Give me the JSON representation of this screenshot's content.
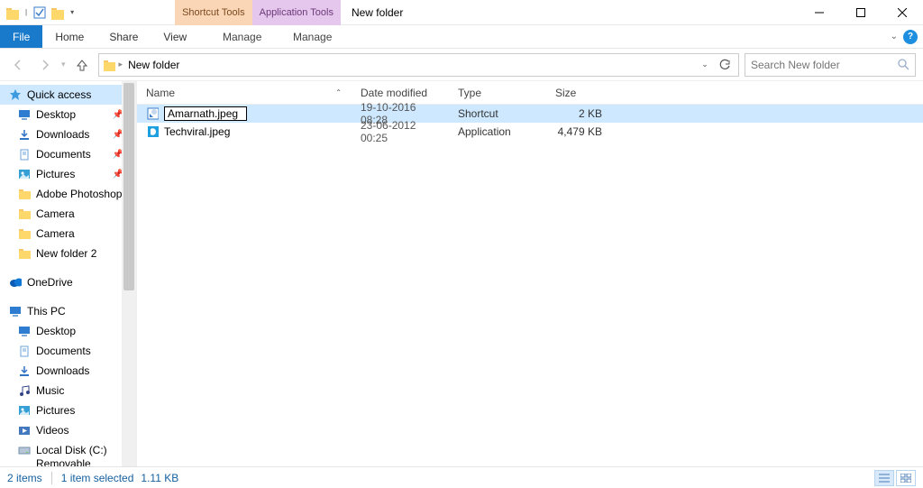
{
  "window": {
    "title": "New folder",
    "context_tabs": {
      "shortcut": "Shortcut Tools",
      "application": "Application Tools"
    },
    "context_sub": {
      "shortcut": "Manage",
      "application": "Manage"
    }
  },
  "ribbon": {
    "file": "File",
    "home": "Home",
    "share": "Share",
    "view": "View"
  },
  "address": {
    "crumb0": "New folder",
    "search_placeholder": "Search New folder"
  },
  "sidebar": {
    "quick_access": "Quick access",
    "items_qa": [
      {
        "label": "Desktop",
        "pin": true
      },
      {
        "label": "Downloads",
        "pin": true
      },
      {
        "label": "Documents",
        "pin": true
      },
      {
        "label": "Pictures",
        "pin": true
      },
      {
        "label": "Adobe Photoshop…",
        "pin": false
      },
      {
        "label": "Camera",
        "pin": false
      },
      {
        "label": "Camera",
        "pin": false
      },
      {
        "label": "New folder 2",
        "pin": false
      }
    ],
    "onedrive": "OneDrive",
    "thispc": "This PC",
    "items_pc": [
      {
        "label": "Desktop"
      },
      {
        "label": "Documents"
      },
      {
        "label": "Downloads"
      },
      {
        "label": "Music"
      },
      {
        "label": "Pictures"
      },
      {
        "label": "Videos"
      },
      {
        "label": "Local Disk (C:)"
      },
      {
        "label": "Removable Disk"
      }
    ]
  },
  "columns": {
    "name": "Name",
    "date": "Date modified",
    "type": "Type",
    "size": "Size"
  },
  "rows": [
    {
      "name": "Amarnath.jpeg",
      "date": "19-10-2016 08:28",
      "type": "Shortcut",
      "size": "2 KB",
      "selected": true,
      "editing": true,
      "icon": "shortcut"
    },
    {
      "name": "Techviral.jpeg",
      "date": "23-06-2012 00:25",
      "type": "Application",
      "size": "4,479 KB",
      "selected": false,
      "editing": false,
      "icon": "app"
    }
  ],
  "status": {
    "count": "2 items",
    "selection": "1 item selected",
    "size": "1.11 KB"
  }
}
